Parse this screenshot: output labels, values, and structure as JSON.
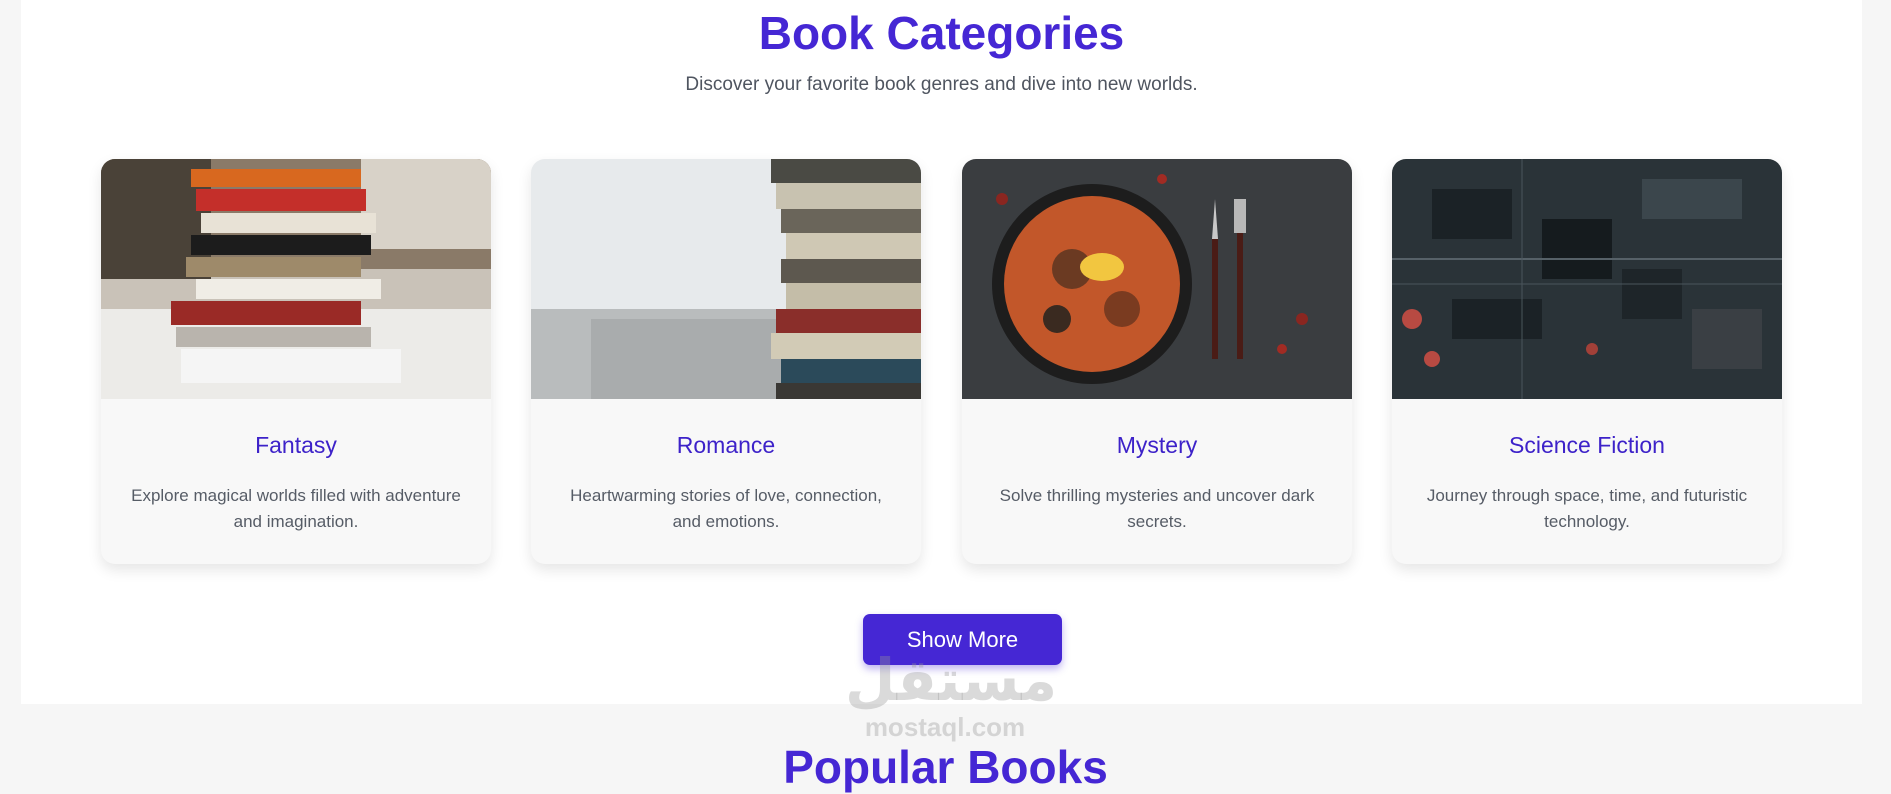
{
  "header": {
    "title": "Book Categories",
    "subtitle": "Discover your favorite book genres and dive into new worlds."
  },
  "cards": [
    {
      "name": "Fantasy",
      "description": "Explore magical worlds filled with adventure and imagination.",
      "image": "book-stack-photo"
    },
    {
      "name": "Romance",
      "description": "Heartwarming stories of love, connection, and emotions.",
      "image": "old-books-photo"
    },
    {
      "name": "Mystery",
      "description": "Solve thrilling mysteries and uncover dark secrets.",
      "image": "paella-pan-photo"
    },
    {
      "name": "Science Fiction",
      "description": "Journey through space, time, and futuristic technology.",
      "image": "circuit-board-photo"
    }
  ],
  "actions": {
    "show_more_label": "Show More"
  },
  "watermark": {
    "arabic": "مستقل",
    "domain": "mostaql.com"
  },
  "next_section": {
    "title_partial": "Popular Books"
  },
  "colors": {
    "accent": "#4527d4",
    "section_bg": "#ffffff",
    "page_bg": "#f6f6f6",
    "card_bg": "#f8f8f8"
  }
}
